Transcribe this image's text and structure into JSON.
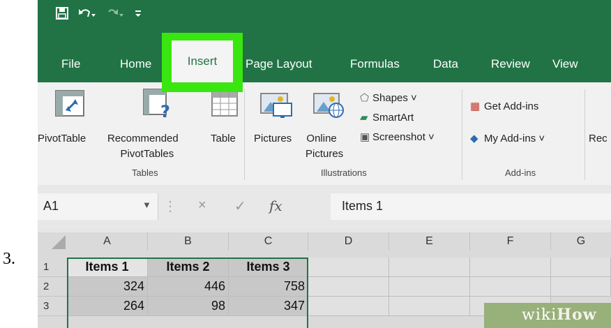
{
  "step_number": "3.",
  "quick_access": {
    "save_icon": "save-icon",
    "undo_icon": "undo-icon",
    "redo_icon": "redo-icon",
    "customize_icon": "customize-icon"
  },
  "tabs": [
    {
      "label": "File"
    },
    {
      "label": "Home"
    },
    {
      "label": "Insert",
      "active": true
    },
    {
      "label": "Page Layout"
    },
    {
      "label": "Formulas"
    },
    {
      "label": "Data"
    },
    {
      "label": "Review"
    },
    {
      "label": "View"
    }
  ],
  "ribbon": {
    "pivottable": "PivotTable",
    "recommended_line1": "Recommended",
    "recommended_line2": "PivotTables",
    "table": "Table",
    "pictures": "Pictures",
    "online_line1": "Online",
    "online_line2": "Pictures",
    "shapes": "Shapes ˅",
    "smartart": "SmartArt",
    "screenshot": "Screenshot ˅",
    "get_addins": "Get Add-ins",
    "my_addins": "My Add-ins ˅",
    "rec_cut": "Rec",
    "groups": {
      "tables": "Tables",
      "illustrations": "Illustrations",
      "addins": "Add-ins"
    }
  },
  "formula_bar": {
    "name_box": "A1",
    "cancel": "×",
    "enter": "✓",
    "fx": "fx",
    "value": "Items 1"
  },
  "sheet": {
    "columns": [
      "A",
      "B",
      "C",
      "D",
      "E",
      "F",
      "G"
    ],
    "rows": [
      "1",
      "2",
      "3"
    ],
    "headers": [
      "Items 1",
      "Items 2",
      "Items 3"
    ],
    "data": [
      [
        "324",
        "446",
        "758"
      ],
      [
        "264",
        "98",
        "347"
      ]
    ]
  },
  "watermark": {
    "wiki": "wiki",
    "how": "How"
  },
  "colors": {
    "excel_green": "#217346",
    "highlight": "#39e60f"
  }
}
